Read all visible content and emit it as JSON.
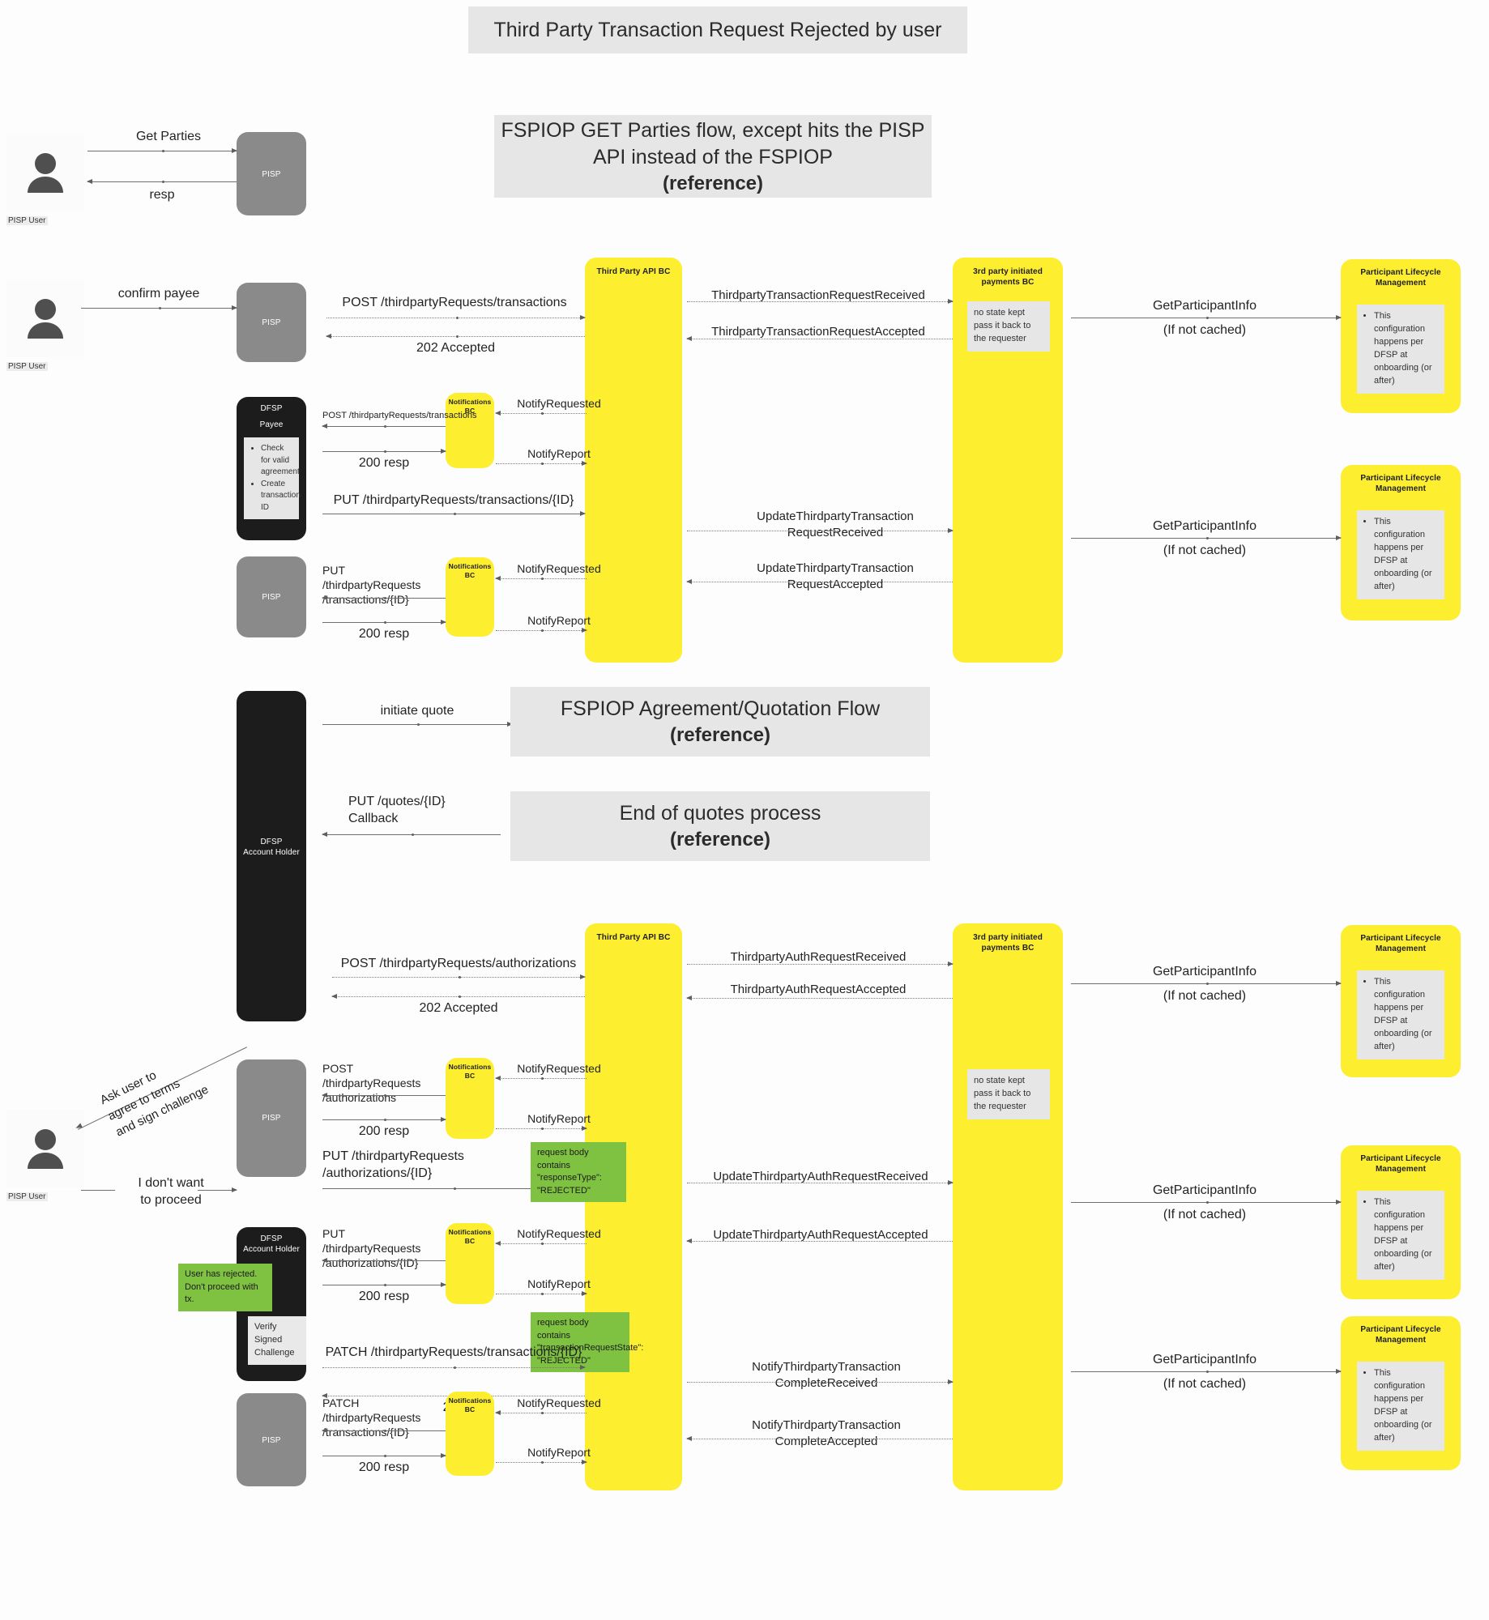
{
  "title": "Third Party Transaction Request Rejected by user",
  "banners": {
    "get_parties": {
      "line1": "FSPIOP GET Parties flow, except hits the PISP",
      "line2": "API instead of the FSPIOP",
      "line3": "(reference)"
    },
    "quotation": {
      "line1": "FSPIOP Agreement/Quotation Flow",
      "line3": "(reference)"
    },
    "end_quotes": {
      "line1": "End of quotes process",
      "line3": "(reference)"
    }
  },
  "actors": {
    "pisp_user": "PISP User"
  },
  "lifelines": {
    "pisp": "PISP",
    "third_party_api_bc": "Third Party API BC",
    "notifications_bc": "Notifications BC",
    "third_party_payments_bc": "3rd party initiated payments BC",
    "plm_line1": "Participant Lifecycle",
    "plm_line2": "Management",
    "dfsp_payee_line1": "DFSP",
    "dfsp_payee_line2": "Payee",
    "dfsp_account_holder_line1": "DFSP",
    "dfsp_account_holder_line2": "Account Holder"
  },
  "notes": {
    "dfsp_payee_bullets": [
      "Check for valid agreement",
      "Create transaction ID"
    ],
    "no_state_kept": "no state kept\npass it back to the requester",
    "plm_config": "This configuration happens per DFSP at onboarding (or after)",
    "verify_signed_challenge": "Verify Signed Challenge",
    "user_rejected": "User has rejected. Don't proceed with tx.",
    "green_response_type": "request body contains\n\"responseType\":\n\"REJECTED\"",
    "green_tx_state": "request body contains\n\"transactionRequestState\":\n\"REJECTED\"",
    "ask_user": "Ask user to\nagree to terms\nand sign challenge"
  },
  "messages": {
    "get_parties": "Get Parties",
    "resp": "resp",
    "confirm_payee": "confirm payee",
    "post_tpr_transactions": "POST /thirdpartyRequests/transactions",
    "accepted_202": "202 Accepted",
    "tptrr_received": "ThirdpartyTransactionRequestReceived",
    "tptrr_accepted": "ThirdpartyTransactionRequestAccepted",
    "get_participant_info": "GetParticipantInfo",
    "if_not_cached": "(If not cached)",
    "post_tpr_transactions_small": "POST /thirdpartyRequests/transactions",
    "resp_200": "200 resp",
    "notify_requested": "NotifyRequested",
    "notify_report": "NotifyReport",
    "put_tpr_transactions_id": "PUT /thirdpartyRequests/transactions/{ID}",
    "put_tpr_transactions_id_l1": "PUT /thirdpartyRequests",
    "put_tpr_transactions_id_l2": "/transactions/{ID}",
    "update_tptr_received_l1": "UpdateThirdpartyTransaction",
    "update_tptr_received_l2": "RequestReceived",
    "update_tptr_accepted_l1": "UpdateThirdpartyTransaction",
    "update_tptr_accepted_l2": "RequestAccepted",
    "initiate_quote": "initiate quote",
    "put_quotes_id_l1": "PUT /quotes/{ID}",
    "put_quotes_id_l2": "Callback",
    "post_tpr_authorizations": "POST /thirdpartyRequests/authorizations",
    "tpar_received": "ThirdpartyAuthRequestReceived",
    "tpar_accepted": "ThirdpartyAuthRequestAccepted",
    "post_tpr_auth_l1": "POST /thirdpartyRequests",
    "post_tpr_auth_l2": "/authorizations",
    "put_tpr_auth_l1": "PUT /thirdpartyRequests",
    "put_tpr_auth_l2": "/authorizations/{ID}",
    "update_tpar_received": "UpdateThirdpartyAuthRequestReceived",
    "update_tpar_accepted": "UpdateThirdpartyAuthRequestAccepted",
    "i_dont_want_l1": "I don't want",
    "i_dont_want_l2": "to proceed",
    "patch_tpr_transactions_id": "PATCH /thirdpartyRequests/transactions/{ID}",
    "patch_tpr_transactions_l1": "PATCH /thirdpartyRequests",
    "patch_tpr_transactions_l2": "/transactions/{ID}",
    "code_200": "200",
    "notify_tptc_received_l1": "NotifyThirdpartyTransaction",
    "notify_tptc_received_l2": "CompleteReceived",
    "notify_tptc_accepted_l1": "NotifyThirdpartyTransaction",
    "notify_tptc_accepted_l2": "CompleteAccepted"
  },
  "colors": {
    "yellow": "#fdee30",
    "grey_lifeline": "#8a8a8a",
    "black_lifeline": "#1c1c1c",
    "banner_grey": "#e6e6e6",
    "green_note": "#7fc242",
    "note_grey": "#e9e9e9"
  }
}
